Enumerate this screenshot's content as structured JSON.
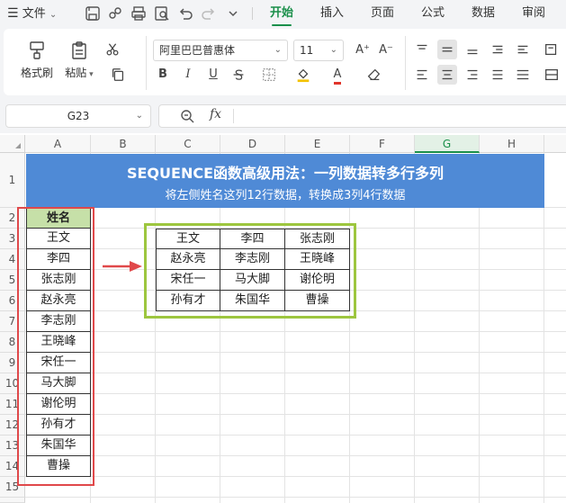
{
  "menubar": {
    "file_label": "文件",
    "tabs": [
      "开始",
      "插入",
      "页面",
      "公式",
      "数据",
      "审阅"
    ],
    "active_tab": "开始"
  },
  "ribbon": {
    "format_painter": "格式刷",
    "paste": "粘贴",
    "font_name": "阿里巴巴普惠体",
    "font_size": "11",
    "bold": "B",
    "italic": "I",
    "underline": "U",
    "grow_font": "A⁺",
    "shrink_font": "A⁻",
    "font_color_letter": "A"
  },
  "formula_bar": {
    "name_box": "G23",
    "fx": "fx",
    "formula": ""
  },
  "grid": {
    "columns": [
      "A",
      "B",
      "C",
      "D",
      "E",
      "F",
      "G",
      "H"
    ],
    "selected_column": "G",
    "rows": [
      "1",
      "2",
      "3",
      "4",
      "5",
      "6",
      "7",
      "8",
      "9",
      "10",
      "11",
      "12",
      "13",
      "14",
      "15"
    ]
  },
  "banner": {
    "title": "SEQUENCE函数高级用法：一列数据转多行多列",
    "subtitle": "将左侧姓名这列12行数据，转换成3列4行数据"
  },
  "source_column": {
    "header": "姓名",
    "names": [
      "王文",
      "李四",
      "张志刚",
      "赵永亮",
      "李志刚",
      "王晓峰",
      "宋任一",
      "马大脚",
      "谢伦明",
      "孙有才",
      "朱国华",
      "曹操"
    ]
  },
  "result_table": [
    [
      "王文",
      "李四",
      "张志刚"
    ],
    [
      "赵永亮",
      "李志刚",
      "王晓峰"
    ],
    [
      "宋任一",
      "马大脚",
      "谢伦明"
    ],
    [
      "孙有才",
      "朱国华",
      "曹操"
    ]
  ],
  "colors": {
    "accent_green": "#1a8f4a",
    "banner_blue": "#4f8ad6",
    "header_green": "#c6e0a8",
    "red_outline": "#e0484a",
    "green_outline": "#9dc63f"
  }
}
